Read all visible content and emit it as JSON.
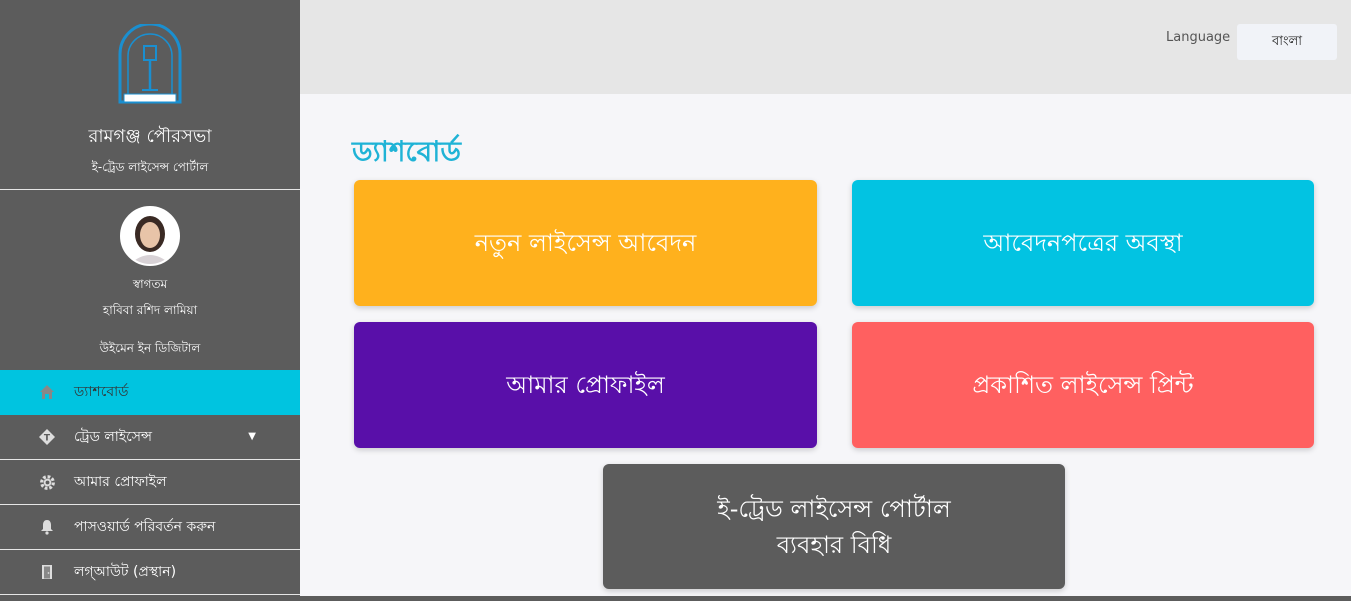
{
  "sidebar": {
    "org_name": "রামগঞ্জ পৌরসভা",
    "portal_name": "ই-ট্রেড লাইসেন্স পোর্টাল",
    "user": {
      "welcome": "স্বাগতম",
      "name": "হাবিবা রশিদ লামিয়া",
      "org": "উইমেন ইন ডিজিটাল"
    },
    "nav": [
      {
        "label": "ড্যাশবোর্ড",
        "icon": "home-icon",
        "active": true
      },
      {
        "label": "ট্রেড লাইসেন্স",
        "icon": "tag-icon",
        "has_submenu": true,
        "caret": "▼"
      },
      {
        "label": "আমার প্রোফাইল",
        "icon": "gear-icon"
      },
      {
        "label": "পাসওয়ার্ড পরিবর্তন করুন",
        "icon": "bell-icon"
      },
      {
        "label": "লগ্‌আউট (প্রস্থান)",
        "icon": "door-icon"
      }
    ]
  },
  "topbar": {
    "language_label": "Language",
    "language_value": "বাংলা"
  },
  "main": {
    "title": "ড্যাশবোর্ড",
    "tiles": [
      {
        "label": "নতুন লাইসেন্স আবেদন",
        "color": "#ffb11d"
      },
      {
        "label": "আবেদনপত্রের অবস্থা",
        "color": "#02c3e2"
      },
      {
        "label": "আমার প্রোফাইল",
        "color": "#590fa9"
      },
      {
        "label": "প্রকাশিত লাইসেন্স প্রিন্ট",
        "color": "#ff6060"
      },
      {
        "label_line1": "ই-ট্রেড লাইসেন্স পোর্টাল",
        "label_line2": "ব্যবহার বিধি",
        "color": "#5c5c5c"
      }
    ]
  },
  "colors": {
    "sidebar_bg": "#5c5c5c",
    "accent": "#00c4e0",
    "title": "#1fb3d6"
  }
}
